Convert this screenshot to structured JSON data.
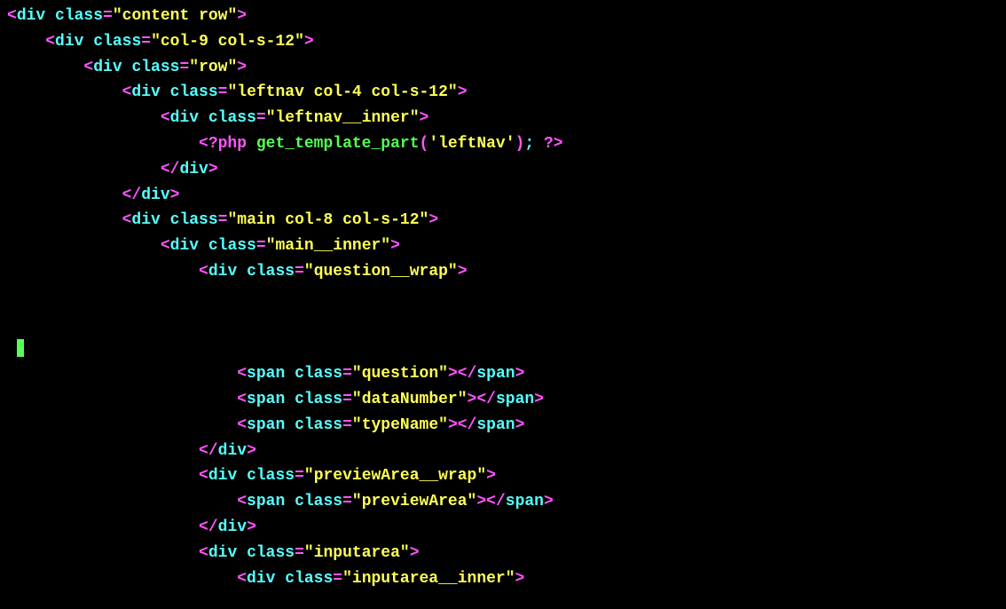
{
  "code": {
    "lt": "<",
    "gt": ">",
    "slash": "/",
    "eq": "=",
    "open_paren": "(",
    "close_paren": ")",
    "semicolon": ";",
    "sp": " ",
    "tag_div": "div",
    "tag_span": "span",
    "attr_class": "class",
    "php_open": "<?php",
    "php_close": "?>",
    "php_fn": "get_template_part",
    "php_arg": "'leftNav'",
    "classes": {
      "content_row": "\"content row\"",
      "col9": "\"col-9 col-s-12\"",
      "row": "\"row\"",
      "leftnav": "\"leftnav col-4 col-s-12\"",
      "leftnav_inner": "\"leftnav__inner\"",
      "main": "\"main col-8 col-s-12\"",
      "main_inner": "\"main__inner\"",
      "question_wrap": "\"question__wrap\"",
      "question": "\"question\"",
      "dataNumber": "\"dataNumber\"",
      "typeName": "\"typeName\"",
      "previewArea_wrap": "\"previewArea__wrap\"",
      "previewArea": "\"previewArea\"",
      "inputarea": "\"inputarea\"",
      "inputarea_inner": "\"inputarea__inner\""
    }
  }
}
